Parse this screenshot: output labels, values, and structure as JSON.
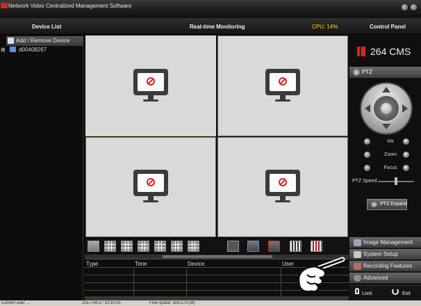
{
  "window": {
    "title": "Network Video Centralized Management Software"
  },
  "headers": {
    "device_list": "Device List",
    "realtime": "Real-time Monitoring",
    "cpu": "CPU: 14%",
    "control_panel": "Control Panel"
  },
  "device_panel": {
    "add_remove": "Add / Remove Device",
    "tree_expander": "⊞",
    "device": "d00408267"
  },
  "branding": {
    "logo": "264 CMS"
  },
  "ptz": {
    "title": "PTZ",
    "iris": "Iris",
    "zoom": "Zoom",
    "focus": "Focus",
    "minus": "−",
    "plus": "+",
    "speed_label": "PTZ Speed",
    "speed_fraction": 0.5,
    "expand": "PTZ Expand"
  },
  "toolbar_icons": [
    "single-view",
    "quad-view",
    "nine-view",
    "sixteen-view",
    "twenty-five-view",
    "thirty-six-view",
    "sixty-four-view",
    "fullscreen",
    "record-all",
    "stop-record",
    "snapshot",
    "record-clip"
  ],
  "log": {
    "columns": [
      "Type",
      "Time",
      "Device",
      "User"
    ]
  },
  "menu": {
    "image_management": "Image Management",
    "system_setup": "System Setup",
    "recording_features": "Recording Features",
    "advanced": "Advanced",
    "lock": "Lock",
    "exit": "Exit"
  },
  "status_bar": {
    "left": "Current user: ...",
    "datetime": "2017-04-27 10:10:05",
    "free_space": "Free space: 305.573 (M)"
  },
  "colors": {
    "accent_red": "#d12a1a",
    "cpu_yellow": "#ffd21f",
    "selected_border": "#e6e678"
  }
}
